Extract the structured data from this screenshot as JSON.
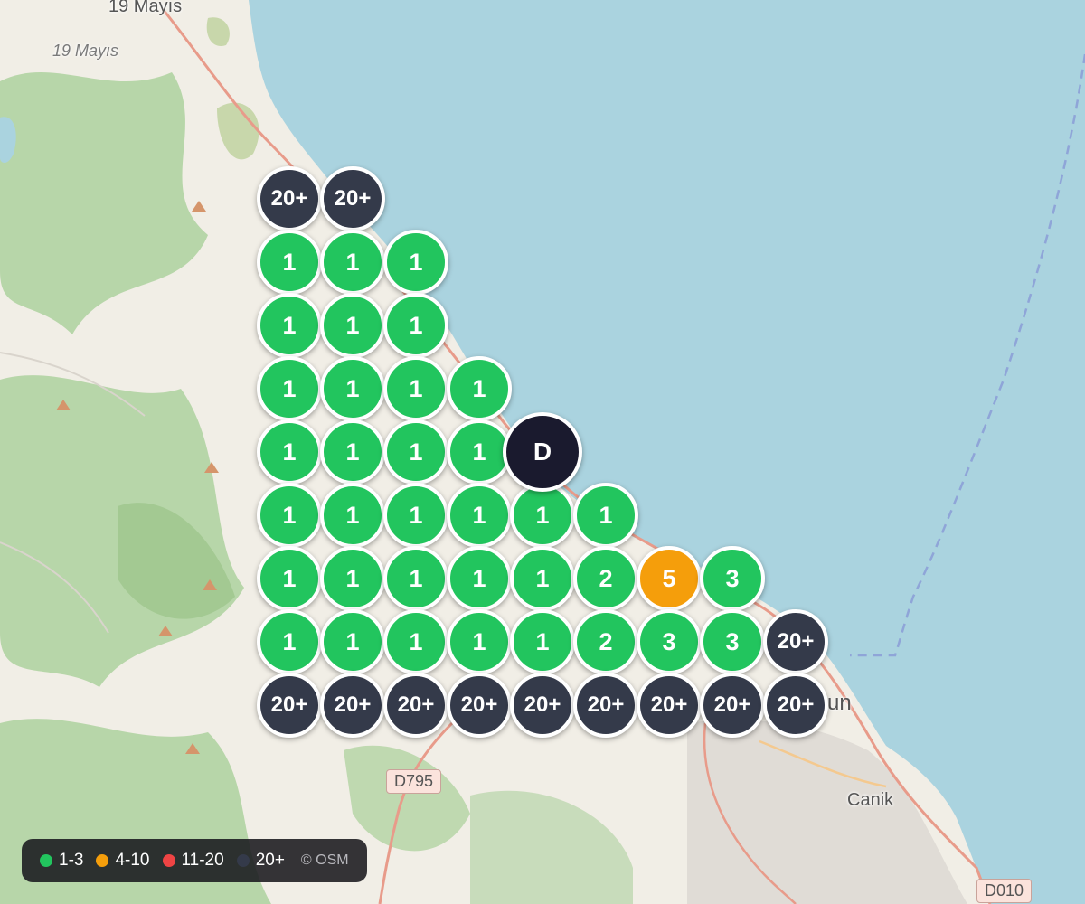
{
  "map": {
    "labels": {
      "town_top": "19 Mayıs",
      "town_top_italic": "19 Mayıs",
      "city_fragment": "un",
      "district": "Canik"
    },
    "roads": {
      "main": "D795",
      "secondary": "D010"
    },
    "colors": {
      "sea": "#aad3df",
      "land": "#f1eee6",
      "forest": "#add19e",
      "cluster_low": "#22c55e",
      "cluster_mid": "#f59e0b",
      "cluster_high": "#ef4444",
      "cluster_max": "#343a4a",
      "destination": "#1a1a2e"
    },
    "grid": {
      "rows": [
        [
          "20+",
          "20+"
        ],
        [
          "1",
          "1",
          "1"
        ],
        [
          "1",
          "1",
          "1"
        ],
        [
          "1",
          "1",
          "1",
          "1"
        ],
        [
          "1",
          "1",
          "1",
          "1"
        ],
        [
          "1",
          "1",
          "1",
          "1",
          "1",
          "1"
        ],
        [
          "1",
          "1",
          "1",
          "1",
          "1",
          "2",
          "5",
          "3"
        ],
        [
          "1",
          "1",
          "1",
          "1",
          "1",
          "2",
          "3",
          "3",
          "20+"
        ],
        [
          "20+",
          "20+",
          "20+",
          "20+",
          "20+",
          "20+",
          "20+",
          "20+",
          "20+"
        ]
      ]
    },
    "destination_marker": {
      "label": "D"
    }
  },
  "legend": {
    "items": [
      {
        "label": "1-3",
        "color": "#22c55e"
      },
      {
        "label": "4-10",
        "color": "#f59e0b"
      },
      {
        "label": "11-20",
        "color": "#ef4444"
      },
      {
        "label": "20+",
        "color": "#343a4a"
      }
    ],
    "attribution": "© OSM"
  }
}
